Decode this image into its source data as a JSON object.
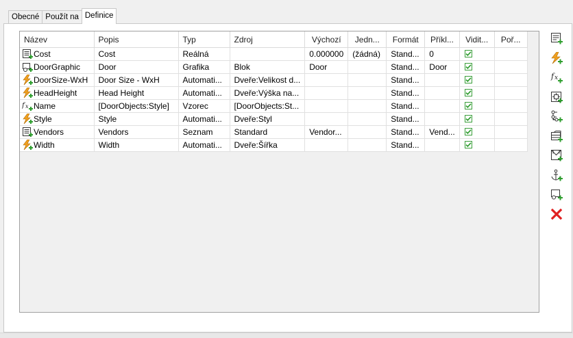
{
  "tabs": [
    {
      "label": "Obecné"
    },
    {
      "label": "Použít na"
    },
    {
      "label": "Definice"
    }
  ],
  "active_tab": 2,
  "columns": [
    {
      "label": "Název",
      "align": "left"
    },
    {
      "label": "Popis",
      "align": "left"
    },
    {
      "label": "Typ",
      "align": "left"
    },
    {
      "label": "Zdroj",
      "align": "left"
    },
    {
      "label": "Výchozí",
      "align": "center"
    },
    {
      "label": "Jedn...",
      "align": "center"
    },
    {
      "label": "Formát",
      "align": "center"
    },
    {
      "label": "Příkl...",
      "align": "center"
    },
    {
      "label": "Vidit...",
      "align": "center"
    },
    {
      "label": "Poř...",
      "align": "center"
    }
  ],
  "rows": [
    {
      "icon": "list-icon",
      "name": "Cost",
      "popis": "Cost",
      "typ": "Reálná",
      "zdroj": "",
      "vychozi": "0.000000",
      "jednotky": "(žádná)",
      "format": "Stand...",
      "priklad": "0",
      "visible": true,
      "poradi": ""
    },
    {
      "icon": "graphic-icon",
      "name": "DoorGraphic",
      "popis": "Door",
      "typ": "Grafika",
      "zdroj": "Blok",
      "vychozi": "Door",
      "jednotky": "",
      "format": "Stand...",
      "priklad": "Door",
      "visible": true,
      "poradi": ""
    },
    {
      "icon": "lightning-icon",
      "name": "DoorSize-WxH",
      "popis": "Door Size - WxH",
      "typ": "Automati...",
      "zdroj": "Dveře:Velikost d...",
      "vychozi": "",
      "jednotky": "",
      "format": "Stand...",
      "priklad": "",
      "visible": true,
      "poradi": ""
    },
    {
      "icon": "lightning-icon",
      "name": "HeadHeight",
      "popis": "Head Height",
      "typ": "Automati...",
      "zdroj": "Dveře:Výška na...",
      "vychozi": "",
      "jednotky": "",
      "format": "Stand...",
      "priklad": "",
      "visible": true,
      "poradi": ""
    },
    {
      "icon": "formula-icon",
      "name": "Name",
      "popis": "[DoorObjects:Style]",
      "typ": "Vzorec",
      "zdroj": "[DoorObjects:St...",
      "vychozi": "",
      "jednotky": "",
      "format": "Stand...",
      "priklad": "",
      "visible": true,
      "poradi": ""
    },
    {
      "icon": "lightning-icon",
      "name": "Style",
      "popis": "Style",
      "typ": "Automati...",
      "zdroj": "Dveře:Styl",
      "vychozi": "",
      "jednotky": "",
      "format": "Stand...",
      "priklad": "",
      "visible": true,
      "poradi": ""
    },
    {
      "icon": "list-icon",
      "name": "Vendors",
      "popis": "Vendors",
      "typ": "Seznam",
      "zdroj": "Standard",
      "vychozi": "Vendor...",
      "jednotky": "",
      "format": "Stand...",
      "priklad": "Vend...",
      "visible": true,
      "poradi": ""
    },
    {
      "icon": "lightning-icon",
      "name": "Width",
      "popis": "Width",
      "typ": "Automati...",
      "zdroj": "Dveře:Šířka",
      "vychozi": "",
      "jednotky": "",
      "format": "Stand...",
      "priklad": "",
      "visible": true,
      "poradi": ""
    }
  ],
  "toolbar": [
    {
      "name": "add-list-property-button",
      "icon": "list-add-icon"
    },
    {
      "name": "add-automatic-property-button",
      "icon": "lightning-add-icon"
    },
    {
      "name": "add-formula-property-button",
      "icon": "formula-add-icon"
    },
    {
      "name": "add-anchor-property-button",
      "icon": "anchor-box-icon"
    },
    {
      "name": "add-classification-property-button",
      "icon": "tree-add-icon"
    },
    {
      "name": "add-material-property-button",
      "icon": "material-add-icon"
    },
    {
      "name": "add-block-property-button",
      "icon": "block-add-icon"
    },
    {
      "name": "add-location-property-button",
      "icon": "anchor-add-icon"
    },
    {
      "name": "add-graphic-property-button",
      "icon": "graphic-add-icon"
    },
    {
      "name": "delete-property-button",
      "icon": "delete-icon"
    }
  ],
  "colors": {
    "accent_green": "#2e9e2e",
    "lightning_orange": "#f0a020",
    "delete_red": "#e02020",
    "check_green": "#2a9a2a"
  }
}
